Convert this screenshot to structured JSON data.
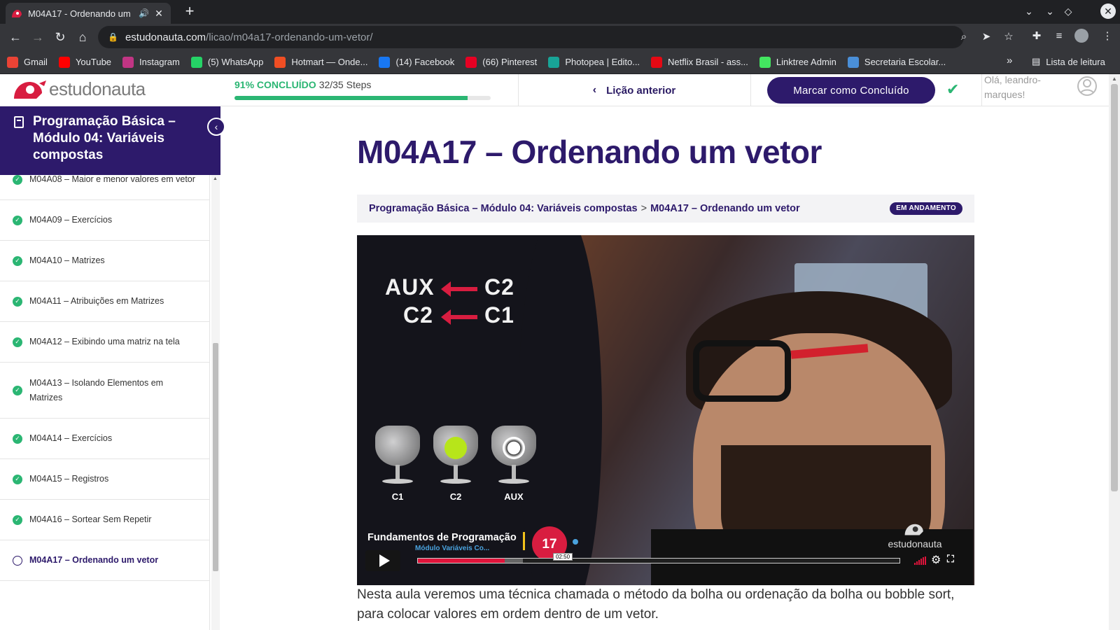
{
  "browser": {
    "tab_title": "M04A17 - Ordenando um",
    "url_host": "estudonauta.com",
    "url_path": "/licao/m04a17-ordenando-um-vetor/",
    "bookmarks": [
      {
        "label": "Gmail",
        "icon": "gmail-icon",
        "color": "#ea4335"
      },
      {
        "label": "YouTube",
        "icon": "youtube-icon",
        "color": "#ff0000"
      },
      {
        "label": "Instagram",
        "icon": "instagram-icon",
        "color": "#c13584"
      },
      {
        "label": "(5) WhatsApp",
        "icon": "whatsapp-icon",
        "color": "#25d366"
      },
      {
        "label": "Hotmart — Onde...",
        "icon": "hotmart-icon",
        "color": "#f04e23"
      },
      {
        "label": "(14) Facebook",
        "icon": "facebook-icon",
        "color": "#1877f2"
      },
      {
        "label": "(66) Pinterest",
        "icon": "pinterest-icon",
        "color": "#e60023"
      },
      {
        "label": "Photopea | Edito...",
        "icon": "photopea-icon",
        "color": "#18a497"
      },
      {
        "label": "Netflix Brasil - ass...",
        "icon": "netflix-icon",
        "color": "#e50914"
      },
      {
        "label": "Linktree Admin",
        "icon": "linktree-icon",
        "color": "#43e660"
      },
      {
        "label": "Secretaria Escolar...",
        "icon": "secretaria-icon",
        "color": "#4a8fd8"
      }
    ],
    "reading_list": "Lista de leitura"
  },
  "header": {
    "logo": "estudonauta",
    "progress_pct": "91% CONCLUÍDO",
    "progress_steps": "32/35 Steps",
    "progress_fraction": 0.91,
    "prev_lesson": "Lição anterior",
    "mark_complete": "Marcar como Concluído",
    "greeting": "Olá, leandro-marques!"
  },
  "sidebar": {
    "course_title": "Programação Básica – Módulo 04: Variáveis compostas",
    "lessons": [
      {
        "label": "M04A08 – Maior e menor valores em vetor",
        "done": true
      },
      {
        "label": "M04A09 – Exercícios",
        "done": true
      },
      {
        "label": "M04A10 – Matrizes",
        "done": true
      },
      {
        "label": "M04A11 – Atribuições em Matrizes",
        "done": true
      },
      {
        "label": "M04A12 – Exibindo uma matriz na tela",
        "done": true
      },
      {
        "label": "M04A13 – Isolando Elementos em Matrizes",
        "done": true
      },
      {
        "label": "M04A14 – Exercícios",
        "done": true
      },
      {
        "label": "M04A15 – Registros",
        "done": true
      },
      {
        "label": "M04A16 – Sortear Sem Repetir",
        "done": true
      },
      {
        "label": "M04A17 – Ordenando um vetor",
        "done": false
      }
    ]
  },
  "main": {
    "title": "M04A17 – Ordenando um vetor",
    "breadcrumb_course": "Programação Básica – Módulo 04: Variáveis compostas",
    "breadcrumb_sep": ">",
    "breadcrumb_lesson": "M04A17 – Ordenando um vetor",
    "status_badge": "EM ANDAMENTO",
    "video": {
      "line1_left": "AUX",
      "line1_right": "C2",
      "line2_left": "C2",
      "line2_right": "C1",
      "glass_labels": [
        "C1",
        "C2",
        "AUX"
      ],
      "caption": "Fundamentos de Programação",
      "subcaption": "Módulo Variáveis Co...",
      "episode_number": "17",
      "brand": "estudonauta",
      "current_time": "02:50",
      "played_fraction": 0.18,
      "buffered_fraction": 0.2
    },
    "description": "Nesta aula veremos uma técnica chamada o método da bolha ou ordenação da bolha ou bobble sort, para colocar valores em ordem dentro de um vetor."
  },
  "colors": {
    "brand_purple": "#2d1a6b",
    "success_green": "#2bb673",
    "accent_red": "#d81d40"
  }
}
